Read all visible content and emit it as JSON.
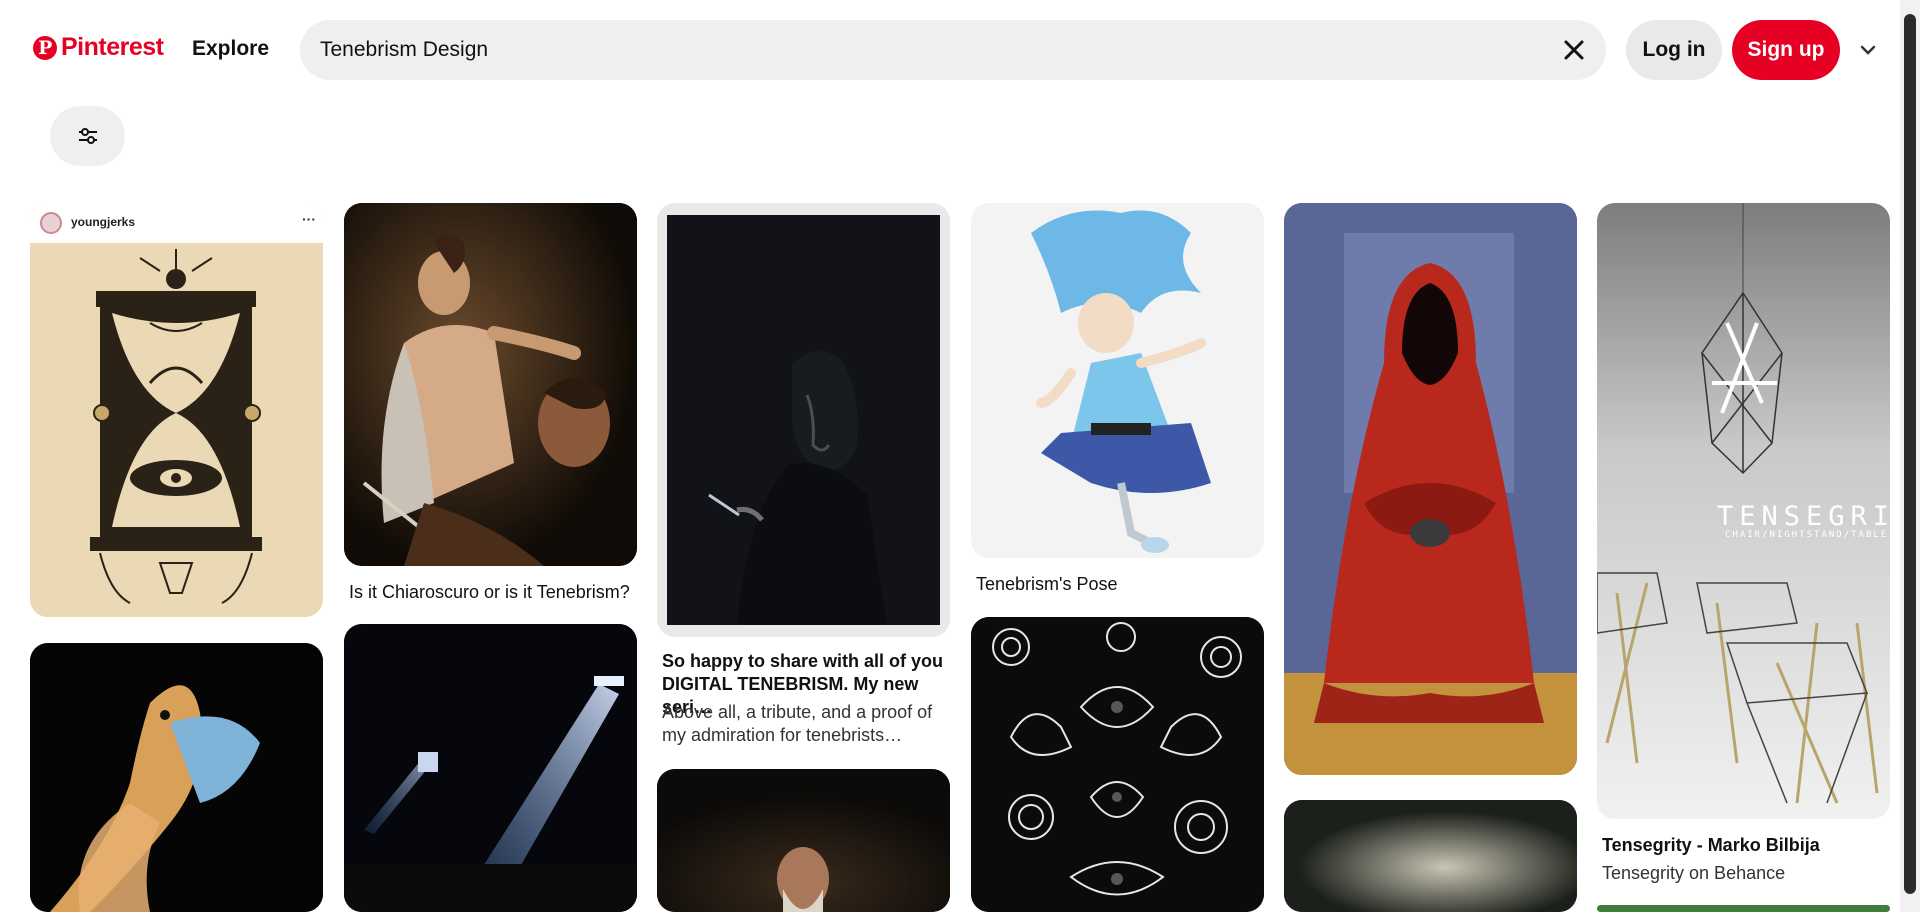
{
  "header": {
    "logo_text": "Pinterest",
    "explore_label": "Explore",
    "search_value": "Tenebrism Design",
    "login_label": "Log in",
    "signup_label": "Sign up"
  },
  "pins": [
    {
      "author": "youngjerks"
    },
    {
      "title": "Is it Chiaroscuro or is it Tenebrism?"
    },
    {
      "title": "So happy to share with all of you DIGITAL TENEBRISM. My new seri…",
      "subtitle": "Above all, a tribute, and a proof of my admiration for tenebrists…"
    },
    {
      "title": "Tenebrism's Pose"
    },
    {},
    {
      "title": "Tensegrity - Marko Bilbija",
      "subtitle": "Tensegrity on Behance",
      "image_text": "TENSEGRITY",
      "image_subtext": "CHAIR/NIGHTSTAND/TABLE"
    }
  ],
  "colors": {
    "brand": "#e60023",
    "search_bg": "#efefef"
  }
}
